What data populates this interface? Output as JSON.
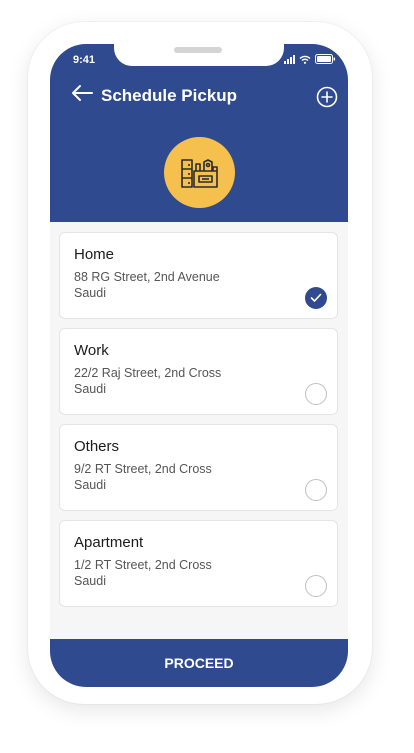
{
  "status_bar": {
    "time": "9:41"
  },
  "header": {
    "title": "Schedule Pickup"
  },
  "icons": {
    "back": "arrow-left-icon",
    "add": "plus-circle-icon",
    "badge": "furniture-icon",
    "check": "checkmark-icon"
  },
  "addresses": [
    {
      "label": "Home",
      "line1": "88 RG Street, 2nd Avenue",
      "line2": "Saudi",
      "selected": true
    },
    {
      "label": "Work",
      "line1": "22/2 Raj Street, 2nd Cross",
      "line2": "Saudi",
      "selected": false
    },
    {
      "label": "Others",
      "line1": "9/2 RT Street, 2nd Cross",
      "line2": "Saudi",
      "selected": false
    },
    {
      "label": "Apartment",
      "line1": "1/2 RT Street, 2nd Cross",
      "line2": "Saudi",
      "selected": false
    }
  ],
  "footer": {
    "proceed_label": "PROCEED"
  },
  "colors": {
    "primary": "#2f4a8f",
    "accent": "#f6c04e",
    "background": "#f6f6f6"
  }
}
